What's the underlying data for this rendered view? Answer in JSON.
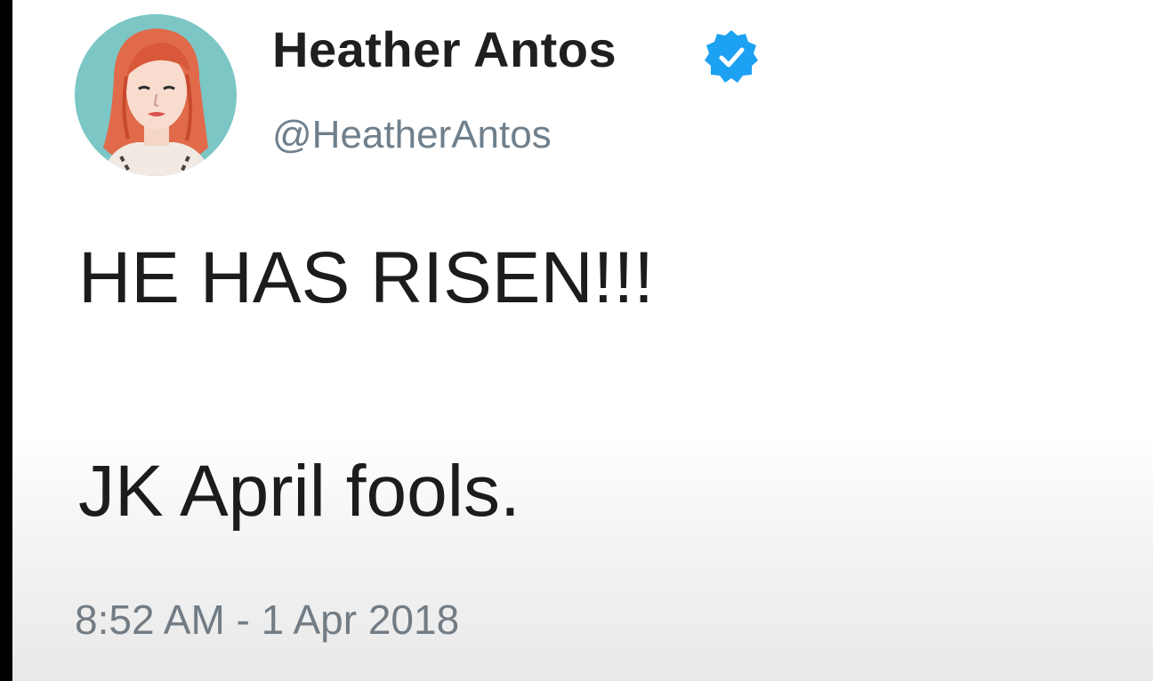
{
  "tweet": {
    "author": {
      "display_name": "Heather Antos",
      "handle": "@HeatherAntos",
      "verified": true,
      "verified_icon": "verified-badge-icon",
      "avatar_icon": "avatar-illustration"
    },
    "text_lines": [
      "HE HAS RISEN!!!",
      "JK April fools."
    ],
    "timestamp": "8:52 AM - 1 Apr 2018"
  },
  "colors": {
    "verified_blue": "#1da1f2",
    "avatar_bg": "#7cc6c6",
    "handle_gray": "#6f7f8c",
    "text": "#1c1c1c"
  }
}
